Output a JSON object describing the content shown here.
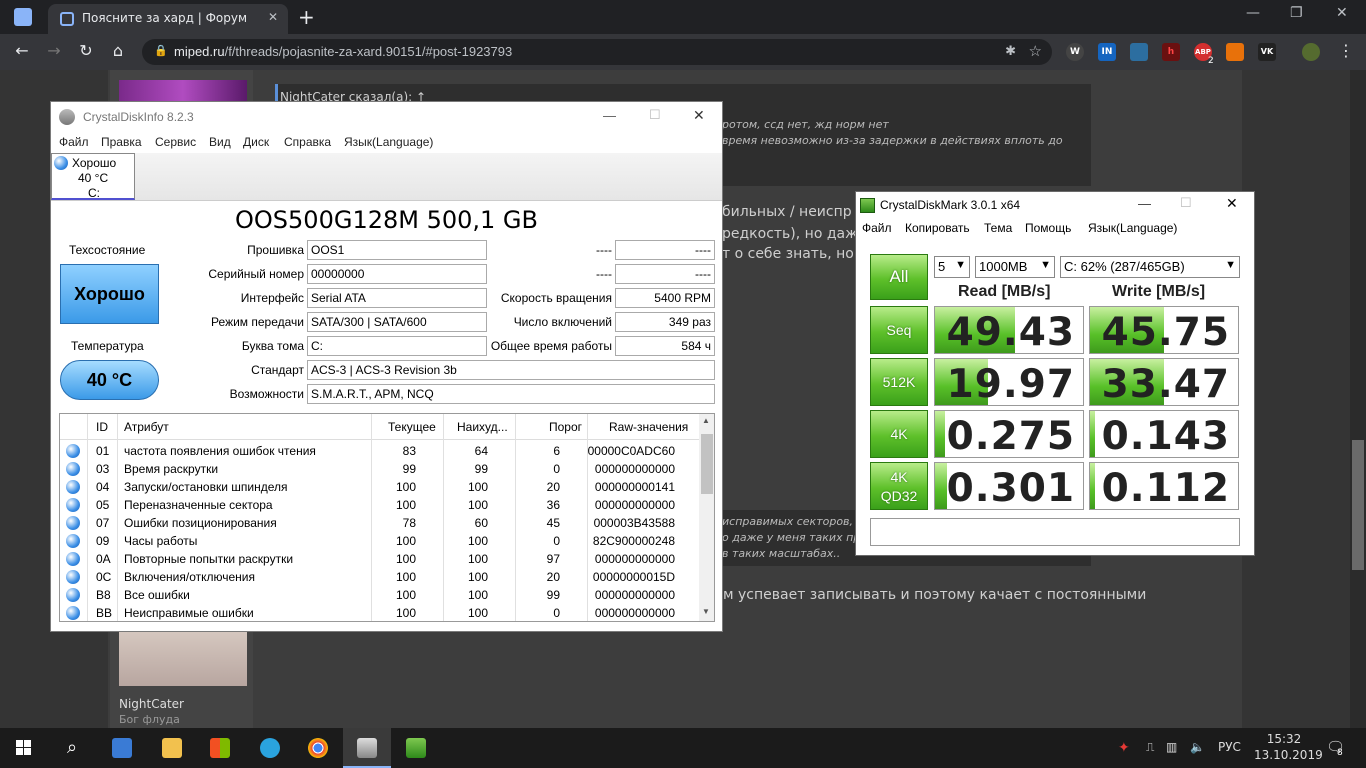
{
  "browser": {
    "tab_title": "Поясните за хард | Форум Miped",
    "tab_close": "✕",
    "new_tab": "+",
    "url_host": "miped.ru",
    "url_path": "/f/threads/pojasnite-za-xard.90151/#post-1923793",
    "win_min": "—",
    "win_max": "❐",
    "win_close": "✕",
    "ext_labels": [
      "W",
      "IN",
      "h",
      "ABP",
      "VK"
    ],
    "ext_badge": "2"
  },
  "forum": {
    "quote_header": "NightCater сказал(а): ↑",
    "quote_line_1": "ротом, ссд нет, жд норм нет",
    "quote_line_2": "время невозможно из-за задержки в действиях вплоть до",
    "post_line_1": "бильных / неиспр",
    "post_line_2": "редкость), но даж",
    "post_line_3": "т о себе знать, но",
    "quote2_line_1": "исправимых секторов,",
    "quote2_line_2": "о даже у меня таких пр",
    "quote2_line_3": "в таких масштабах..",
    "post_line_4": "м успевает записывать и поэтому качает с постоянными",
    "username": "NightCater",
    "usertitle": "Бог флуда"
  },
  "cdi": {
    "title": "CrystalDiskInfo 8.2.3",
    "menu": [
      "Файл",
      "Правка",
      "Сервис",
      "Вид",
      "Диск",
      "Справка",
      "Язык(Language)"
    ],
    "disk_tab": {
      "status": "Хорошо",
      "temp": "40 °C",
      "letter": "C:"
    },
    "model": "OOS500G128M 500,1 GB",
    "health_label": "Техсостояние",
    "health_value": "Хорошо",
    "temp_label": "Температура",
    "temp_value": "40 °C",
    "labels": {
      "firmware": "Прошивка",
      "serial": "Серийный номер",
      "interface": "Интерфейс",
      "transfer": "Режим передачи",
      "drive_letter": "Буква тома",
      "standard": "Стандарт",
      "features": "Возможности",
      "rotation": "Скорость вращения",
      "power_count": "Число включений",
      "power_hours": "Общее время работы",
      "blank": "----"
    },
    "values": {
      "firmware": "OOS1",
      "serial": "00000000",
      "interface": "Serial ATA",
      "transfer": "SATA/300 | SATA/600",
      "drive_letter": "C:",
      "standard": "ACS-3 | ACS-3 Revision 3b",
      "features": "S.M.A.R.T., APM, NCQ",
      "rotation": "5400 RPM",
      "power_count": "349 раз",
      "power_hours": "584 ч",
      "blank": "----"
    },
    "smart_headers": [
      "ID",
      "Атрибут",
      "Текущее",
      "Наихуд...",
      "Порог",
      "Raw-значения"
    ],
    "smart_rows": [
      [
        "01",
        "частота появления ошибок чтения",
        "83",
        "64",
        "6",
        "00000C0ADC60"
      ],
      [
        "03",
        "Время раскрутки",
        "99",
        "99",
        "0",
        "000000000000"
      ],
      [
        "04",
        "Запуски/остановки шпинделя",
        "100",
        "100",
        "20",
        "000000000141"
      ],
      [
        "05",
        "Переназначенные сектора",
        "100",
        "100",
        "36",
        "000000000000"
      ],
      [
        "07",
        "Ошибки позиционирования",
        "78",
        "60",
        "45",
        "000003B43588"
      ],
      [
        "09",
        "Часы работы",
        "100",
        "100",
        "0",
        "82C900000248"
      ],
      [
        "0A",
        "Повторные попытки раскрутки",
        "100",
        "100",
        "97",
        "000000000000"
      ],
      [
        "0C",
        "Включения/отключения",
        "100",
        "100",
        "20",
        "00000000015D"
      ],
      [
        "B8",
        "Все ошибки",
        "100",
        "100",
        "99",
        "000000000000"
      ],
      [
        "BB",
        "Неисправимые ошибки",
        "100",
        "100",
        "0",
        "000000000000"
      ]
    ]
  },
  "cdm": {
    "title": "CrystalDiskMark 3.0.1 x64",
    "menu": [
      "Файл",
      "Копировать",
      "Тема",
      "Помощь",
      "Язык(Language)"
    ],
    "all_label": "All",
    "count": "5",
    "size": "1000MB",
    "drive": "C: 62% (287/465GB)",
    "read_header": "Read [MB/s]",
    "write_header": "Write [MB/s]",
    "tests": [
      {
        "label": "Seq",
        "label2": "",
        "read": "49.43",
        "write": "45.75",
        "read_fill": 0.54,
        "write_fill": 0.5
      },
      {
        "label": "512K",
        "label2": "",
        "read": "19.97",
        "write": "33.47",
        "read_fill": 0.36,
        "write_fill": 0.5
      },
      {
        "label": "4K",
        "label2": "",
        "read": "0.275",
        "write": "0.143",
        "read_fill": 0.07,
        "write_fill": 0.03
      },
      {
        "label": "4K",
        "label2": "QD32",
        "read": "0.301",
        "write": "0.112",
        "read_fill": 0.08,
        "write_fill": 0.02
      }
    ],
    "comment": ""
  },
  "taskbar": {
    "lang": "РУС",
    "time": "15:32",
    "date": "13.10.2019",
    "notif_count": "8"
  }
}
